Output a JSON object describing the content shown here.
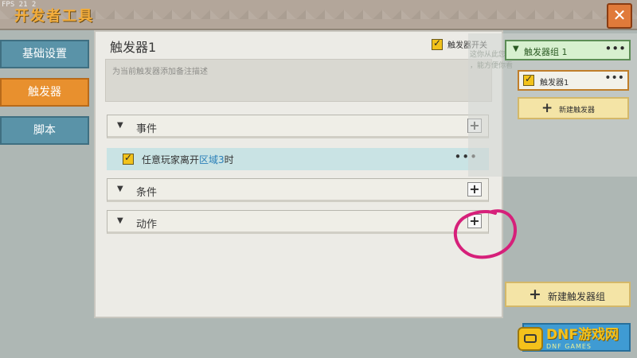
{
  "window": {
    "fps": "FPS 21 2",
    "title": "开发者工具",
    "close_glyph": "✕"
  },
  "nav": {
    "items": [
      {
        "label": "基础设置"
      },
      {
        "label": "触发器"
      },
      {
        "label": "脚本"
      }
    ],
    "active_index": 1
  },
  "main": {
    "title": "触发器1",
    "switch_label": "触发器开关",
    "switch_checked": true,
    "remark_placeholder": "为当前触发器添加备注描述",
    "sections": [
      {
        "label": "事件",
        "expanded": true
      },
      {
        "label": "条件",
        "expanded": true
      },
      {
        "label": "动作",
        "expanded": true
      }
    ],
    "event_row": {
      "checked": true,
      "text_before": "任意玩家离开",
      "region_link": "区域3",
      "text_after": "时",
      "more": "•••"
    },
    "add_glyph": "+",
    "collapse_glyph": "▼"
  },
  "right": {
    "group_label": "触发器组 1",
    "group_more": "•••",
    "hint_line1": "这你从此您的触发器组后面的",
    "hint_line2": "，能方便你看",
    "trigger_item": {
      "label": "触发器1",
      "checked": true,
      "more": "•••"
    },
    "new_trigger": {
      "label": "新建触发器",
      "plus": "+"
    },
    "new_group": {
      "label": "新建触发器组",
      "plus": "+"
    }
  },
  "watermark": {
    "main": "DNF游戏网",
    "sub": "DNF GAMES"
  },
  "colors": {
    "title_orange": "#f3ad3b",
    "nav_blue": "#5a93a8",
    "nav_active": "#e8902e",
    "annotation_pink": "#d6207a",
    "checkbox_yellow": "#f2c21b"
  }
}
